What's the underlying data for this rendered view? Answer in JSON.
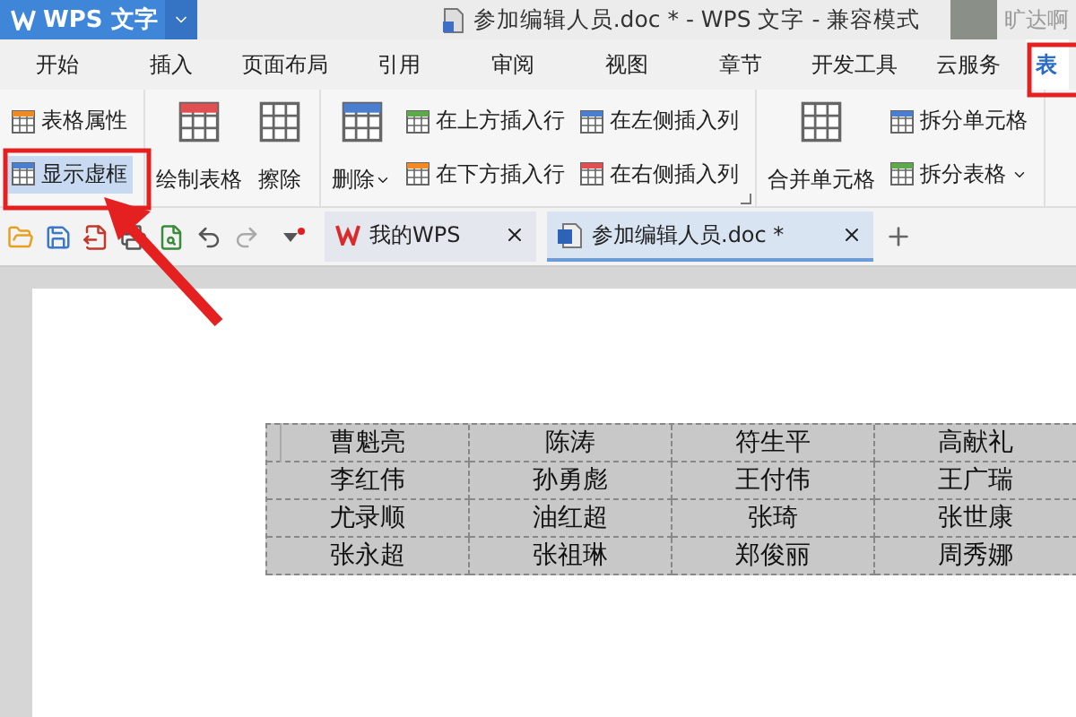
{
  "app": {
    "name": "WPS 文字"
  },
  "title": "参加编辑人员.doc * - WPS 文字 - 兼容模式",
  "user": {
    "name": "旷达啊"
  },
  "menu_tabs": [
    {
      "label": "开始",
      "selected": false
    },
    {
      "label": "插入",
      "selected": false
    },
    {
      "label": "页面布局",
      "selected": false
    },
    {
      "label": "引用",
      "selected": false
    },
    {
      "label": "审阅",
      "selected": false
    },
    {
      "label": "视图",
      "selected": false
    },
    {
      "label": "章节",
      "selected": false
    },
    {
      "label": "开发工具",
      "selected": false
    },
    {
      "label": "云服务",
      "selected": false
    },
    {
      "label": "表",
      "selected": true
    }
  ],
  "ribbon": {
    "groups": [
      {
        "items": [
          {
            "kind": "small",
            "label": "表格属性",
            "active": false
          },
          {
            "kind": "small",
            "label": "显示虚框",
            "active": true
          }
        ]
      },
      {
        "items": [
          {
            "kind": "large",
            "label": "绘制表格",
            "dropdown": false
          },
          {
            "kind": "large",
            "label": "擦除",
            "dropdown": false
          }
        ]
      },
      {
        "launcher": true,
        "items": [
          {
            "kind": "large",
            "label": "删除",
            "dropdown": true
          },
          {
            "kind": "small",
            "label": "在上方插入行",
            "active": false
          },
          {
            "kind": "small",
            "label": "在下方插入行",
            "active": false
          },
          {
            "kind": "small",
            "label": "在左侧插入列",
            "active": false
          },
          {
            "kind": "small",
            "label": "在右侧插入列",
            "active": false
          }
        ]
      },
      {
        "items": [
          {
            "kind": "large",
            "label": "合并单元格",
            "dropdown": false
          },
          {
            "kind": "small",
            "label": "拆分单元格",
            "active": false,
            "dropdown": false
          },
          {
            "kind": "small",
            "label": "拆分表格",
            "active": false,
            "dropdown": true
          }
        ]
      }
    ]
  },
  "doc_tabs": [
    {
      "label": "我的WPS",
      "selected": false
    },
    {
      "label": "参加编辑人员.doc *",
      "selected": true
    }
  ],
  "table": {
    "rows": [
      [
        "曹魁亮",
        "陈涛",
        "符生平",
        "高献礼"
      ],
      [
        "李红伟",
        "孙勇彪",
        "王付伟",
        "王广瑞"
      ],
      [
        "尤录顺",
        "油红超",
        "张琦",
        "张世康"
      ],
      [
        "张永超",
        "张祖琳",
        "郑俊丽",
        "周秀娜"
      ]
    ]
  }
}
